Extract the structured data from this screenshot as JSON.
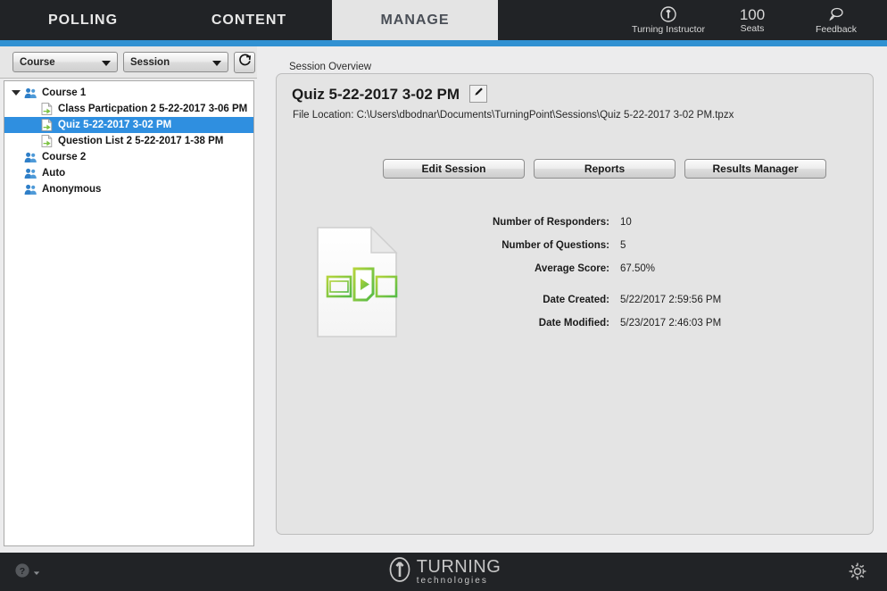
{
  "header": {
    "tabs": [
      {
        "label": "POLLING",
        "active": false
      },
      {
        "label": "CONTENT",
        "active": false
      },
      {
        "label": "MANAGE",
        "active": true
      }
    ],
    "account": {
      "icon": "turning-logo-icon",
      "label": "Turning Instructor"
    },
    "seats": {
      "value": "100",
      "label": "Seats"
    },
    "feedback": {
      "icon": "feedback-bubble-icon",
      "label": "Feedback"
    }
  },
  "sidebar": {
    "course_filter": {
      "value": "Course",
      "icon": "chevron-down-icon"
    },
    "session_filter": {
      "value": "Session",
      "icon": "chevron-down-icon"
    },
    "refresh": {
      "icon": "refresh-icon"
    },
    "tree": [
      {
        "label": "Course 1",
        "level": 0,
        "icon": "course-people-icon",
        "expanded": true,
        "selected": false
      },
      {
        "label": "Class Particpation 2 5-22-2017 3-06 PM",
        "level": 1,
        "icon": "session-document-icon",
        "selected": false
      },
      {
        "label": "Quiz 5-22-2017 3-02 PM",
        "level": 1,
        "icon": "session-document-icon",
        "selected": true
      },
      {
        "label": "Question List 2 5-22-2017 1-38 PM",
        "level": 1,
        "icon": "session-document-icon",
        "selected": false
      },
      {
        "label": "Course 2",
        "level": 0,
        "icon": "course-people-icon",
        "expanded": false,
        "selected": false
      },
      {
        "label": "Auto",
        "level": 0,
        "icon": "course-people-icon",
        "expanded": false,
        "selected": false
      },
      {
        "label": "Anonymous",
        "level": 0,
        "icon": "course-people-icon",
        "expanded": false,
        "selected": false
      }
    ]
  },
  "main": {
    "group_label": "Session Overview",
    "session_title": "Quiz 5-22-2017 3-02 PM",
    "edit_icon": "pencil-icon",
    "file_location": "File Location: C:\\Users\\dbodnar\\Documents\\TurningPoint\\Sessions\\Quiz 5-22-2017 3-02 PM.tpzx",
    "buttons": [
      {
        "label": "Edit Session"
      },
      {
        "label": "Reports"
      },
      {
        "label": "Results Manager"
      }
    ],
    "document_icon": "session-file-large-icon",
    "stats": [
      {
        "label": "Number of Responders:",
        "value": "10",
        "gap": false
      },
      {
        "label": "Number of Questions:",
        "value": "5",
        "gap": false
      },
      {
        "label": "Average Score:",
        "value": "67.50%",
        "gap": false
      },
      {
        "label": "Date Created:",
        "value": "5/22/2017 2:59:56 PM",
        "gap": true
      },
      {
        "label": "Date Modified:",
        "value": "5/23/2017 2:46:03 PM",
        "gap": false
      }
    ]
  },
  "footer": {
    "help": {
      "icon": "help-circle-icon",
      "caret": "chevron-down-icon"
    },
    "logo": {
      "main": "TURNING",
      "sub": "technologies"
    },
    "settings": {
      "icon": "gear-icon"
    }
  },
  "colors": {
    "header_bg": "#212326",
    "accent": "#3191d2",
    "selection": "#2f8fe0",
    "panel_bg": "#e4e4e4",
    "app_bg": "#ececed",
    "icon_green": "#8cc63f"
  }
}
